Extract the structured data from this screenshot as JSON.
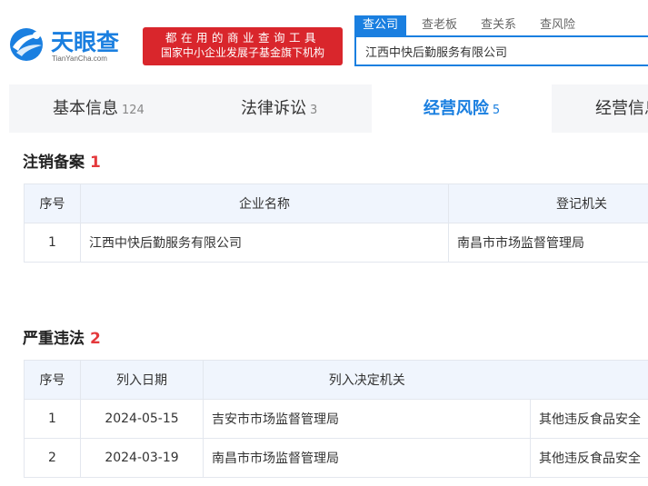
{
  "header": {
    "logo_name": "天眼查",
    "logo_domain": "TianYanCha.com",
    "slogan_line1": "都在用的商业查询工具",
    "slogan_line2": "国家中小企业发展子基金旗下机构",
    "search_tabs": [
      "查公司",
      "查老板",
      "查关系",
      "查风险"
    ],
    "search_value": "江西中快后勤服务有限公司"
  },
  "nav": {
    "tabs": [
      {
        "label": "基本信息",
        "count": "124"
      },
      {
        "label": "法律诉讼",
        "count": "3"
      },
      {
        "label": "经营风险",
        "count": "5"
      },
      {
        "label": "经营信息",
        "count": ""
      }
    ]
  },
  "deregistration": {
    "title": "注销备案",
    "count": "1",
    "headers": [
      "序号",
      "企业名称",
      "登记机关"
    ],
    "rows": [
      [
        "1",
        "江西中快后勤服务有限公司",
        "南昌市市场监督管理局"
      ]
    ]
  },
  "violations": {
    "title": "严重违法",
    "count": "2",
    "headers": [
      "序号",
      "列入日期",
      "列入决定机关",
      ""
    ],
    "rows": [
      [
        "1",
        "2024-05-15",
        "吉安市市场监督管理局",
        "其他违反食品安全"
      ],
      [
        "2",
        "2024-03-19",
        "南昌市市场监督管理局",
        "其他违反食品安全"
      ]
    ]
  },
  "colors": {
    "brand_blue": "#1a7fe0",
    "slogan_red": "#d9262c",
    "count_red": "#e4393c"
  }
}
